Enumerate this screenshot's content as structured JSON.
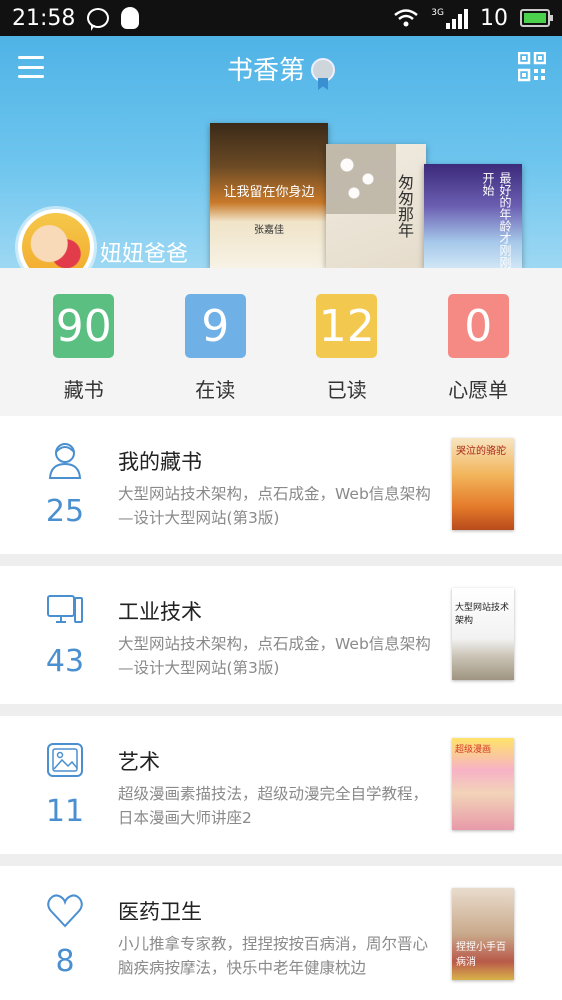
{
  "status_bar": {
    "time": "21:58",
    "network": "3G",
    "battery": "10"
  },
  "header": {
    "title": "书香第",
    "username": "妞妞爸爸",
    "books": [
      {
        "title": "让我留在你身边",
        "author": "张嘉佳"
      },
      {
        "title": "匆匆那年"
      },
      {
        "title": "最好的年龄才刚刚开始"
      }
    ]
  },
  "stats": [
    {
      "value": "90",
      "label": "藏书",
      "color": "#5cbf82"
    },
    {
      "value": "9",
      "label": "在读",
      "color": "#6fb0e6"
    },
    {
      "value": "12",
      "label": "已读",
      "color": "#f2c84f"
    },
    {
      "value": "0",
      "label": "心愿单",
      "color": "#f58a85"
    }
  ],
  "categories": [
    {
      "name": "我的藏书",
      "count": "25",
      "desc": "大型网站技术架构，点石成金，Web信息架构—设计大型网站(第3版)",
      "icon": "person-icon",
      "cover_text": "哭泣的骆驼"
    },
    {
      "name": "工业技术",
      "count": "43",
      "desc": "大型网站技术架构，点石成金，Web信息架构—设计大型网站(第3版)",
      "icon": "computer-icon",
      "cover_text": "大型网站技术架构"
    },
    {
      "name": "艺术",
      "count": "11",
      "desc": "超级漫画素描技法，超级动漫完全自学教程，日本漫画大师讲座2",
      "icon": "picture-icon",
      "cover_text": "超级漫画"
    },
    {
      "name": "医药卫生",
      "count": "8",
      "desc": "小儿推拿专家教，捏捏按按百病消，周尔晋心脑疾病按摩法，快乐中老年健康枕边",
      "icon": "heart-icon",
      "cover_text": "捏捏小手百病消"
    }
  ],
  "colors": {
    "accent": "#4a8fd0",
    "header_top": "#4fb3e6"
  }
}
